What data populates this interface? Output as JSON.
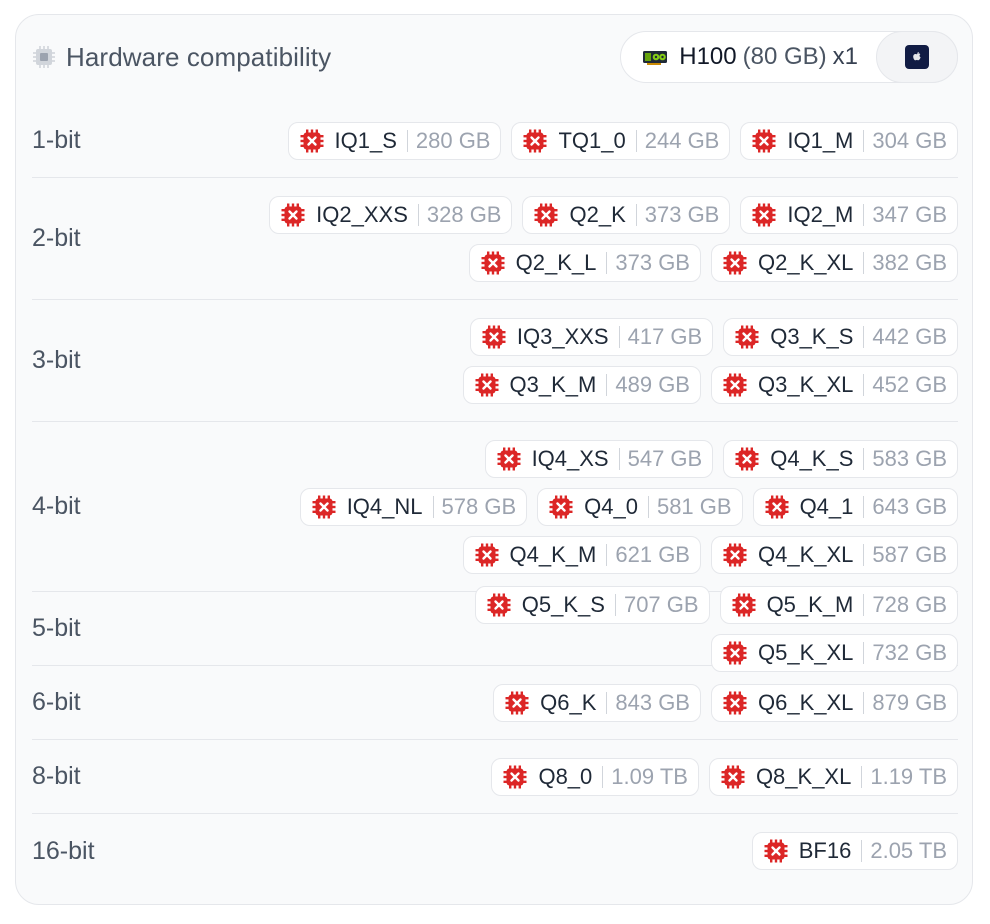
{
  "header": {
    "title": "Hardware compatibility",
    "hardware": {
      "name": "H100",
      "memory": "(80 GB)",
      "count": "x1"
    }
  },
  "colors": {
    "error": "#dc2626",
    "apple_tile": "#111c44"
  },
  "rows": [
    {
      "bits": "1-bit",
      "quants": [
        {
          "name": "IQ1_S",
          "size": "280 GB"
        },
        {
          "name": "TQ1_0",
          "size": "244 GB"
        },
        {
          "name": "IQ1_M",
          "size": "304 GB"
        }
      ]
    },
    {
      "bits": "2-bit",
      "quants": [
        {
          "name": "IQ2_XXS",
          "size": "328 GB"
        },
        {
          "name": "Q2_K",
          "size": "373 GB"
        },
        {
          "name": "IQ2_M",
          "size": "347 GB"
        },
        {
          "name": "Q2_K_L",
          "size": "373 GB"
        },
        {
          "name": "Q2_K_XL",
          "size": "382 GB"
        }
      ]
    },
    {
      "bits": "3-bit",
      "quants": [
        {
          "name": "IQ3_XXS",
          "size": "417 GB"
        },
        {
          "name": "Q3_K_S",
          "size": "442 GB"
        },
        {
          "name": "Q3_K_M",
          "size": "489 GB"
        },
        {
          "name": "Q3_K_XL",
          "size": "452 GB"
        }
      ]
    },
    {
      "bits": "4-bit",
      "quants": [
        {
          "name": "IQ4_XS",
          "size": "547 GB"
        },
        {
          "name": "Q4_K_S",
          "size": "583 GB"
        },
        {
          "name": "IQ4_NL",
          "size": "578 GB"
        },
        {
          "name": "Q4_0",
          "size": "581 GB"
        },
        {
          "name": "Q4_1",
          "size": "643 GB"
        },
        {
          "name": "Q4_K_M",
          "size": "621 GB"
        },
        {
          "name": "Q4_K_XL",
          "size": "587 GB"
        }
      ]
    },
    {
      "bits": "5-bit",
      "quants": [
        {
          "name": "Q5_K_S",
          "size": "707 GB"
        },
        {
          "name": "Q5_K_M",
          "size": "728 GB"
        },
        {
          "name": "Q5_K_XL",
          "size": "732 GB"
        }
      ]
    },
    {
      "bits": "6-bit",
      "quants": [
        {
          "name": "Q6_K",
          "size": "843 GB"
        },
        {
          "name": "Q6_K_XL",
          "size": "879 GB"
        }
      ]
    },
    {
      "bits": "8-bit",
      "quants": [
        {
          "name": "Q8_0",
          "size": "1.09 TB"
        },
        {
          "name": "Q8_K_XL",
          "size": "1.19 TB"
        }
      ]
    },
    {
      "bits": "16-bit",
      "quants": [
        {
          "name": "BF16",
          "size": "2.05 TB"
        }
      ]
    }
  ]
}
